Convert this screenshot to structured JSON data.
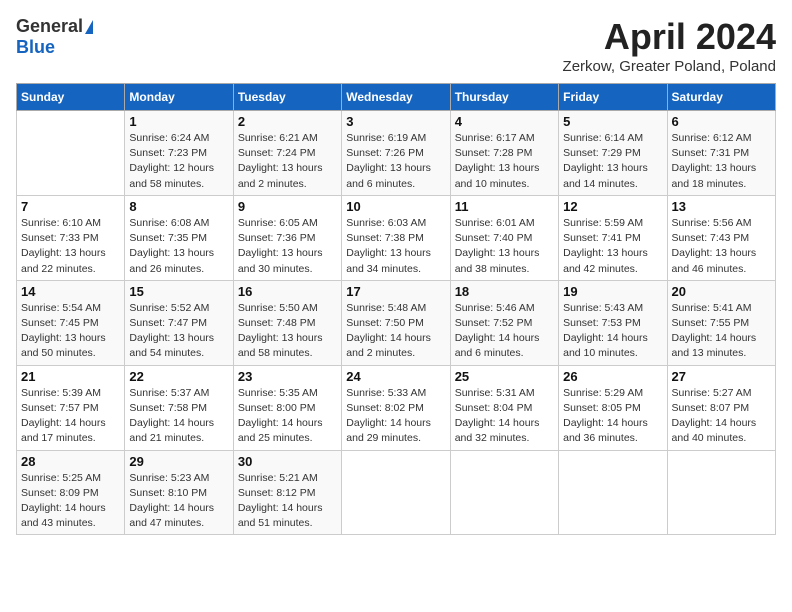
{
  "header": {
    "logo_general": "General",
    "logo_blue": "Blue",
    "month": "April 2024",
    "location": "Zerkow, Greater Poland, Poland"
  },
  "days_of_week": [
    "Sunday",
    "Monday",
    "Tuesday",
    "Wednesday",
    "Thursday",
    "Friday",
    "Saturday"
  ],
  "weeks": [
    [
      {
        "day": "",
        "info": ""
      },
      {
        "day": "1",
        "info": "Sunrise: 6:24 AM\nSunset: 7:23 PM\nDaylight: 12 hours\nand 58 minutes."
      },
      {
        "day": "2",
        "info": "Sunrise: 6:21 AM\nSunset: 7:24 PM\nDaylight: 13 hours\nand 2 minutes."
      },
      {
        "day": "3",
        "info": "Sunrise: 6:19 AM\nSunset: 7:26 PM\nDaylight: 13 hours\nand 6 minutes."
      },
      {
        "day": "4",
        "info": "Sunrise: 6:17 AM\nSunset: 7:28 PM\nDaylight: 13 hours\nand 10 minutes."
      },
      {
        "day": "5",
        "info": "Sunrise: 6:14 AM\nSunset: 7:29 PM\nDaylight: 13 hours\nand 14 minutes."
      },
      {
        "day": "6",
        "info": "Sunrise: 6:12 AM\nSunset: 7:31 PM\nDaylight: 13 hours\nand 18 minutes."
      }
    ],
    [
      {
        "day": "7",
        "info": "Sunrise: 6:10 AM\nSunset: 7:33 PM\nDaylight: 13 hours\nand 22 minutes."
      },
      {
        "day": "8",
        "info": "Sunrise: 6:08 AM\nSunset: 7:35 PM\nDaylight: 13 hours\nand 26 minutes."
      },
      {
        "day": "9",
        "info": "Sunrise: 6:05 AM\nSunset: 7:36 PM\nDaylight: 13 hours\nand 30 minutes."
      },
      {
        "day": "10",
        "info": "Sunrise: 6:03 AM\nSunset: 7:38 PM\nDaylight: 13 hours\nand 34 minutes."
      },
      {
        "day": "11",
        "info": "Sunrise: 6:01 AM\nSunset: 7:40 PM\nDaylight: 13 hours\nand 38 minutes."
      },
      {
        "day": "12",
        "info": "Sunrise: 5:59 AM\nSunset: 7:41 PM\nDaylight: 13 hours\nand 42 minutes."
      },
      {
        "day": "13",
        "info": "Sunrise: 5:56 AM\nSunset: 7:43 PM\nDaylight: 13 hours\nand 46 minutes."
      }
    ],
    [
      {
        "day": "14",
        "info": "Sunrise: 5:54 AM\nSunset: 7:45 PM\nDaylight: 13 hours\nand 50 minutes."
      },
      {
        "day": "15",
        "info": "Sunrise: 5:52 AM\nSunset: 7:47 PM\nDaylight: 13 hours\nand 54 minutes."
      },
      {
        "day": "16",
        "info": "Sunrise: 5:50 AM\nSunset: 7:48 PM\nDaylight: 13 hours\nand 58 minutes."
      },
      {
        "day": "17",
        "info": "Sunrise: 5:48 AM\nSunset: 7:50 PM\nDaylight: 14 hours\nand 2 minutes."
      },
      {
        "day": "18",
        "info": "Sunrise: 5:46 AM\nSunset: 7:52 PM\nDaylight: 14 hours\nand 6 minutes."
      },
      {
        "day": "19",
        "info": "Sunrise: 5:43 AM\nSunset: 7:53 PM\nDaylight: 14 hours\nand 10 minutes."
      },
      {
        "day": "20",
        "info": "Sunrise: 5:41 AM\nSunset: 7:55 PM\nDaylight: 14 hours\nand 13 minutes."
      }
    ],
    [
      {
        "day": "21",
        "info": "Sunrise: 5:39 AM\nSunset: 7:57 PM\nDaylight: 14 hours\nand 17 minutes."
      },
      {
        "day": "22",
        "info": "Sunrise: 5:37 AM\nSunset: 7:58 PM\nDaylight: 14 hours\nand 21 minutes."
      },
      {
        "day": "23",
        "info": "Sunrise: 5:35 AM\nSunset: 8:00 PM\nDaylight: 14 hours\nand 25 minutes."
      },
      {
        "day": "24",
        "info": "Sunrise: 5:33 AM\nSunset: 8:02 PM\nDaylight: 14 hours\nand 29 minutes."
      },
      {
        "day": "25",
        "info": "Sunrise: 5:31 AM\nSunset: 8:04 PM\nDaylight: 14 hours\nand 32 minutes."
      },
      {
        "day": "26",
        "info": "Sunrise: 5:29 AM\nSunset: 8:05 PM\nDaylight: 14 hours\nand 36 minutes."
      },
      {
        "day": "27",
        "info": "Sunrise: 5:27 AM\nSunset: 8:07 PM\nDaylight: 14 hours\nand 40 minutes."
      }
    ],
    [
      {
        "day": "28",
        "info": "Sunrise: 5:25 AM\nSunset: 8:09 PM\nDaylight: 14 hours\nand 43 minutes."
      },
      {
        "day": "29",
        "info": "Sunrise: 5:23 AM\nSunset: 8:10 PM\nDaylight: 14 hours\nand 47 minutes."
      },
      {
        "day": "30",
        "info": "Sunrise: 5:21 AM\nSunset: 8:12 PM\nDaylight: 14 hours\nand 51 minutes."
      },
      {
        "day": "",
        "info": ""
      },
      {
        "day": "",
        "info": ""
      },
      {
        "day": "",
        "info": ""
      },
      {
        "day": "",
        "info": ""
      }
    ]
  ]
}
